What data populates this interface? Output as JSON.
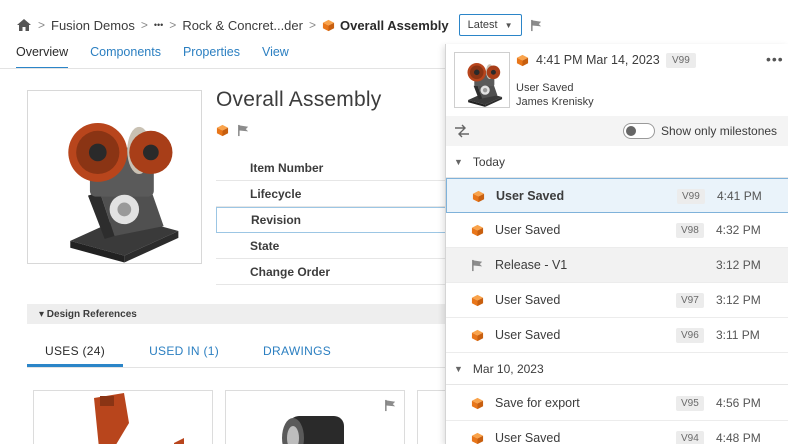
{
  "breadcrumb": {
    "project": "Fusion Demos",
    "ellipsis": "•••",
    "folder": "Rock & Concret...der",
    "current": "Overall Assembly",
    "version_selector": "Latest"
  },
  "tabs": [
    {
      "label": "Overview",
      "active": true
    },
    {
      "label": "Components",
      "active": false
    },
    {
      "label": "Properties",
      "active": false
    },
    {
      "label": "View",
      "active": false
    }
  ],
  "item": {
    "title": "Overall Assembly",
    "properties": [
      "Item Number",
      "Lifecycle",
      "Revision",
      "State",
      "Change Order"
    ]
  },
  "references": {
    "section_label": "▾ Design References",
    "subtabs": [
      {
        "label": "USES (24)",
        "active": true
      },
      {
        "label": "USED IN (1)",
        "active": false
      },
      {
        "label": "DRAWINGS",
        "active": false
      }
    ]
  },
  "version_panel": {
    "header": {
      "time": "4:41 PM Mar 14, 2023",
      "version": "V99",
      "action": "User Saved",
      "user": "James Krenisky",
      "more": "•••"
    },
    "milestones_toggle": {
      "label": "Show only milestones",
      "on": false
    },
    "groups": [
      {
        "label": "Today",
        "rows": [
          {
            "type": "version",
            "label": "User Saved",
            "version": "V99",
            "time": "4:41 PM",
            "selected": true
          },
          {
            "type": "version",
            "label": "User Saved",
            "version": "V98",
            "time": "4:32 PM",
            "selected": false
          },
          {
            "type": "milestone",
            "label": "Release - V1",
            "version": "",
            "time": "3:12 PM",
            "selected": false
          },
          {
            "type": "version",
            "label": "User Saved",
            "version": "V97",
            "time": "3:12 PM",
            "selected": false
          },
          {
            "type": "version",
            "label": "User Saved",
            "version": "V96",
            "time": "3:11 PM",
            "selected": false
          }
        ]
      },
      {
        "label": "Mar 10, 2023",
        "rows": [
          {
            "type": "version",
            "label": "Save for export",
            "version": "V95",
            "time": "4:56 PM",
            "selected": false
          },
          {
            "type": "version",
            "label": "User Saved",
            "version": "V94",
            "time": "4:48 PM",
            "selected": false
          }
        ]
      }
    ]
  },
  "colors": {
    "accent": "#2b85c8",
    "link": "#2b7fc1",
    "cube_orange": "#f07f1e",
    "selected_row": "#eaf3fa"
  }
}
